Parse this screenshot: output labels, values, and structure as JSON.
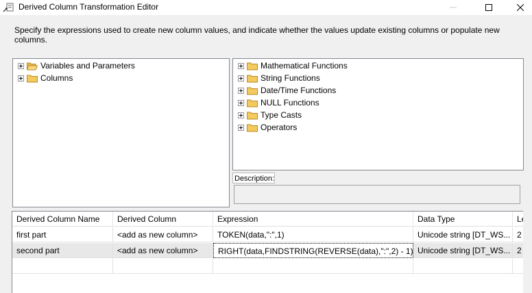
{
  "window": {
    "title": "Derived Column Transformation Editor"
  },
  "instructions": "Specify the expressions used to create new column values, and indicate whether the values update existing columns or populate new columns.",
  "left_tree": [
    {
      "label": "Variables and Parameters",
      "icon": "folder-open-icon"
    },
    {
      "label": "Columns",
      "icon": "folder-icon"
    }
  ],
  "right_tree": [
    {
      "label": "Mathematical Functions"
    },
    {
      "label": "String Functions"
    },
    {
      "label": "Date/Time Functions"
    },
    {
      "label": "NULL Functions"
    },
    {
      "label": "Type Casts"
    },
    {
      "label": "Operators"
    }
  ],
  "description": {
    "label": "Description:",
    "value": ""
  },
  "grid": {
    "headers": [
      "Derived Column Name",
      "Derived Column",
      "Expression",
      "Data Type",
      "Le"
    ],
    "rows": [
      {
        "name": "first part",
        "derived": "<add as new column>",
        "expression": "TOKEN(data,\":\",1)",
        "datatype": "Unicode string [DT_WS...",
        "length": "2"
      },
      {
        "name": "second part",
        "derived": "<add as new column>",
        "expression": "RIGHT(data,FINDSTRING(REVERSE(data),\":\",2) - 1)",
        "datatype": "Unicode string [DT_WS...",
        "length": "2"
      }
    ]
  },
  "colors": {
    "folder": "#f4c95d",
    "selected_row": "#e8e8e8"
  }
}
